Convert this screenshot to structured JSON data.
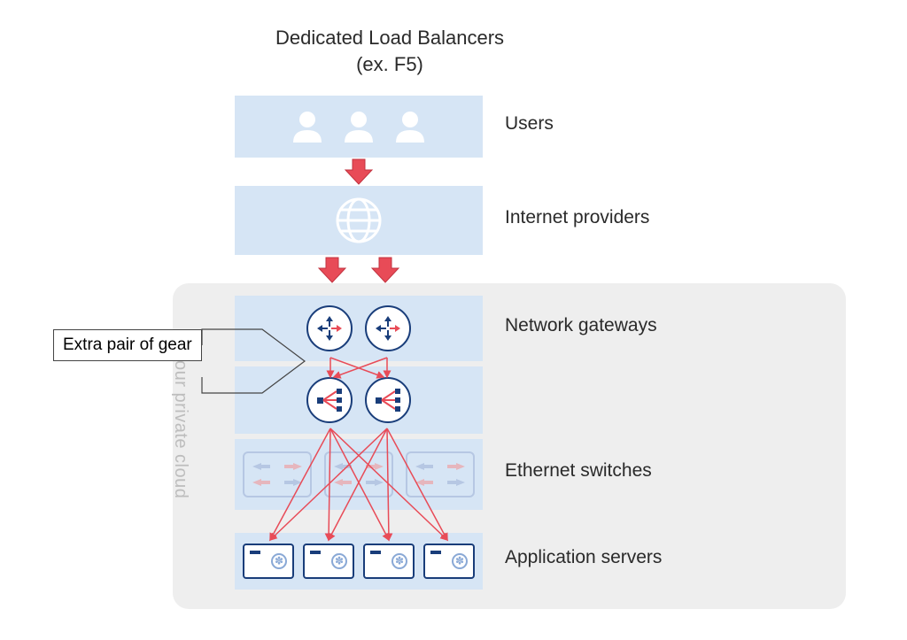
{
  "title_line1": "Dedicated Load Balancers",
  "title_line2": "(ex. F5)",
  "cloud_label": "Your private cloud",
  "callout_text": "Extra pair of gear",
  "layers": {
    "users": {
      "label": "Users"
    },
    "isp": {
      "label": "Internet providers"
    },
    "gw": {
      "label": "Network gateways"
    },
    "swt": {
      "label": "Ethernet switches"
    },
    "srv": {
      "label": "Application servers"
    }
  },
  "colors": {
    "layer_bg": "#d6e5f5",
    "cloud_bg": "#eeeeee",
    "navy": "#193d7a",
    "red": "#e84b57"
  }
}
